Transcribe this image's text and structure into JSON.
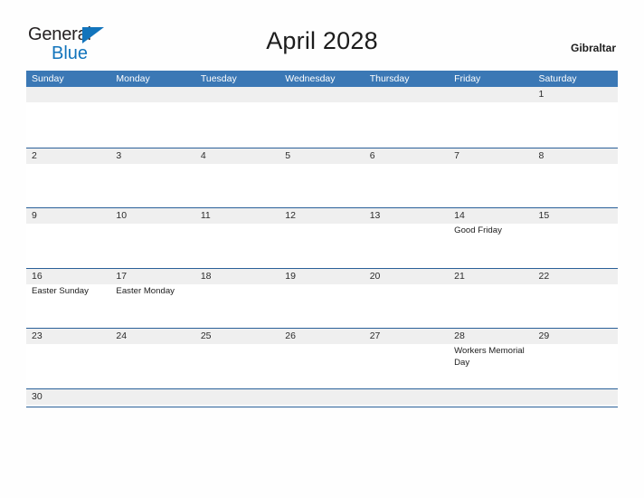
{
  "brand": {
    "line1": "General",
    "line2": "Blue",
    "triangle_color": "#1274bc",
    "text_color": "#231f20"
  },
  "header": {
    "title": "April 2028",
    "region": "Gibraltar"
  },
  "theme": {
    "header_blue": "#3b78b5",
    "rule_blue": "#2a6099",
    "date_band_gray": "#efefef",
    "page_background": "#fefefe"
  },
  "calendar": {
    "month": "April",
    "year": "2028",
    "weekdays": [
      "Sunday",
      "Monday",
      "Tuesday",
      "Wednesday",
      "Thursday",
      "Friday",
      "Saturday"
    ],
    "weeks": [
      [
        {
          "day": "",
          "events": []
        },
        {
          "day": "",
          "events": []
        },
        {
          "day": "",
          "events": []
        },
        {
          "day": "",
          "events": []
        },
        {
          "day": "",
          "events": []
        },
        {
          "day": "",
          "events": []
        },
        {
          "day": "1",
          "events": []
        }
      ],
      [
        {
          "day": "2",
          "events": []
        },
        {
          "day": "3",
          "events": []
        },
        {
          "day": "4",
          "events": []
        },
        {
          "day": "5",
          "events": []
        },
        {
          "day": "6",
          "events": []
        },
        {
          "day": "7",
          "events": []
        },
        {
          "day": "8",
          "events": []
        }
      ],
      [
        {
          "day": "9",
          "events": []
        },
        {
          "day": "10",
          "events": []
        },
        {
          "day": "11",
          "events": []
        },
        {
          "day": "12",
          "events": []
        },
        {
          "day": "13",
          "events": []
        },
        {
          "day": "14",
          "events": [
            "Good Friday"
          ]
        },
        {
          "day": "15",
          "events": []
        }
      ],
      [
        {
          "day": "16",
          "events": [
            "Easter Sunday"
          ]
        },
        {
          "day": "17",
          "events": [
            "Easter Monday"
          ]
        },
        {
          "day": "18",
          "events": []
        },
        {
          "day": "19",
          "events": []
        },
        {
          "day": "20",
          "events": []
        },
        {
          "day": "21",
          "events": []
        },
        {
          "day": "22",
          "events": []
        }
      ],
      [
        {
          "day": "23",
          "events": []
        },
        {
          "day": "24",
          "events": []
        },
        {
          "day": "25",
          "events": []
        },
        {
          "day": "26",
          "events": []
        },
        {
          "day": "27",
          "events": []
        },
        {
          "day": "28",
          "events": [
            "Workers Memorial Day"
          ]
        },
        {
          "day": "29",
          "events": []
        }
      ],
      [
        {
          "day": "30",
          "events": []
        },
        {
          "day": "",
          "events": []
        },
        {
          "day": "",
          "events": []
        },
        {
          "day": "",
          "events": []
        },
        {
          "day": "",
          "events": []
        },
        {
          "day": "",
          "events": []
        },
        {
          "day": "",
          "events": []
        }
      ]
    ]
  }
}
